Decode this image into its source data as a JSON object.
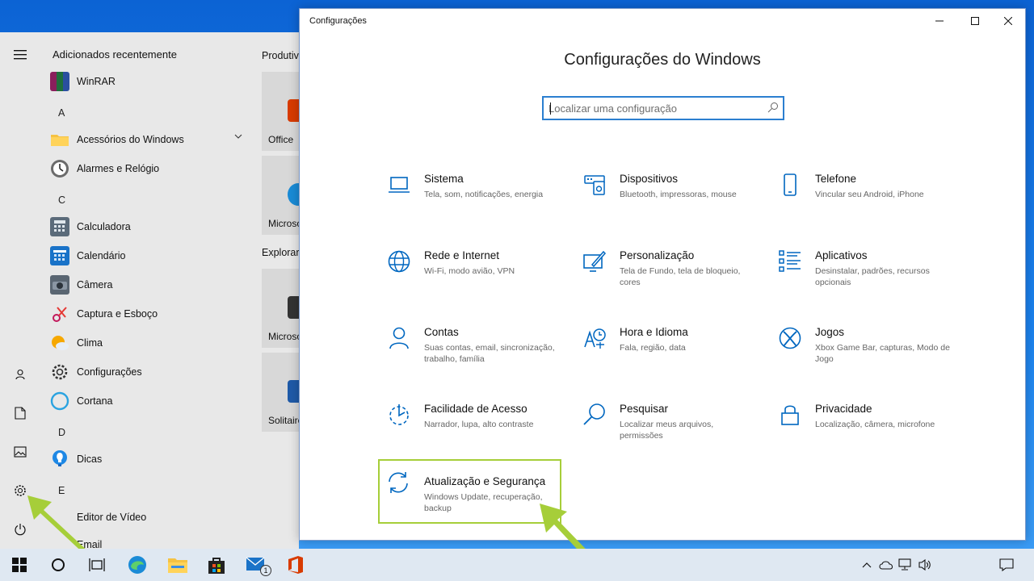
{
  "start_menu": {
    "header": "Adicionados recentemente",
    "apps": [
      {
        "label": "WinRAR"
      },
      {
        "letter": "A"
      },
      {
        "label": "Acessórios do Windows"
      },
      {
        "label": "Alarmes e Relógio"
      },
      {
        "letter": "C"
      },
      {
        "label": "Calculadora"
      },
      {
        "label": "Calendário"
      },
      {
        "label": "Câmera"
      },
      {
        "label": "Captura e Esboço"
      },
      {
        "label": "Clima"
      },
      {
        "label": "Configurações"
      },
      {
        "label": "Cortana"
      },
      {
        "letter": "D"
      },
      {
        "label": "Dicas"
      },
      {
        "letter": "E"
      },
      {
        "label": "Editor de Vídeo"
      },
      {
        "label": "Email"
      }
    ],
    "tile_groups": [
      {
        "title": "Produtividade",
        "tiles": [
          "Office",
          "Microsoft Edge"
        ]
      },
      {
        "title": "Explorar",
        "tiles": [
          "Microsoft Store",
          "Solitaire"
        ]
      }
    ]
  },
  "window": {
    "title": "Configurações",
    "heading": "Configurações do Windows",
    "search_placeholder": "Localizar uma configuração",
    "categories": [
      {
        "title": "Sistema",
        "desc": "Tela, som, notificações, energia",
        "icon": "laptop-icon"
      },
      {
        "title": "Dispositivos",
        "desc": "Bluetooth, impressoras, mouse",
        "icon": "devices-icon"
      },
      {
        "title": "Telefone",
        "desc": "Vincular seu Android, iPhone",
        "icon": "phone-icon"
      },
      {
        "title": "Rede e Internet",
        "desc": "Wi-Fi, modo avião, VPN",
        "icon": "globe-icon"
      },
      {
        "title": "Personalização",
        "desc": "Tela de Fundo, tela de bloqueio, cores",
        "icon": "paint-icon"
      },
      {
        "title": "Aplicativos",
        "desc": "Desinstalar, padrões, recursos opcionais",
        "icon": "apps-list-icon"
      },
      {
        "title": "Contas",
        "desc": "Suas contas, email, sincronização, trabalho, família",
        "icon": "person-icon"
      },
      {
        "title": "Hora e Idioma",
        "desc": "Fala, região, data",
        "icon": "time-language-icon"
      },
      {
        "title": "Jogos",
        "desc": "Xbox Game Bar, capturas, Modo de Jogo",
        "icon": "xbox-icon"
      },
      {
        "title": "Facilidade de Acesso",
        "desc": "Narrador, lupa, alto contraste",
        "icon": "ease-of-access-icon"
      },
      {
        "title": "Pesquisar",
        "desc": "Localizar meus arquivos, permissões",
        "icon": "search-icon"
      },
      {
        "title": "Privacidade",
        "desc": "Localização, câmera, microfone",
        "icon": "lock-icon"
      },
      {
        "title": "Atualização e Segurança",
        "desc": "Windows Update, recuperação, backup",
        "icon": "sync-icon",
        "highlighted": true
      }
    ]
  },
  "taskbar": {
    "mail_badge": "1"
  },
  "colors": {
    "accent": "#0067c0",
    "highlight": "#a6ce39",
    "arrow": "#a6ce39"
  }
}
